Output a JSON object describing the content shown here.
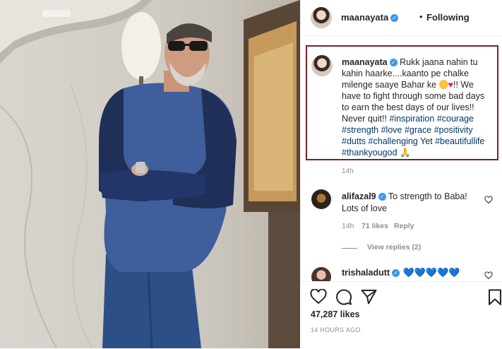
{
  "post": {
    "author": "maanayata",
    "follow_status": "Following",
    "separator": "•"
  },
  "caption": {
    "username": "maanayata",
    "text_part1": "Rukk jaana nahin tu kahin haarke....kaanto pe chalke milenge saaye Bahar ke",
    "text_part2": "!! We have to fight through some bad days to earn the best days of our lives!! Never quit!!",
    "hashtags": [
      "#inspiration",
      "#courage",
      "#strength",
      "#love",
      "#grace",
      "#positivity",
      "#dutts",
      "#challenging"
    ],
    "text_part3": "Yet",
    "hashtags2": [
      "#beautifullife",
      "#thankyougod"
    ],
    "time": "14h"
  },
  "comments": [
    {
      "username": "alifazal9",
      "text": "To strength to Baba! Lots of love",
      "time": "14h",
      "likes": "71 likes",
      "reply_label": "Reply",
      "view_replies": "View replies (2)"
    },
    {
      "username": "trishaladutt",
      "hearts": "💙💙💙💙💙"
    }
  ],
  "footer": {
    "likes": "47,287 likes",
    "time_ago": "14 HOURS AGO"
  },
  "icons": {
    "like": "heart-outline-icon",
    "comment": "comment-bubble-icon",
    "share": "paper-plane-icon",
    "save": "bookmark-icon",
    "verified": "verified-badge-icon"
  },
  "colors": {
    "highlight_border": "#7a1f2a",
    "verified": "#3897f0",
    "hashtag": "#00376b",
    "muted": "#8e8e8e"
  }
}
